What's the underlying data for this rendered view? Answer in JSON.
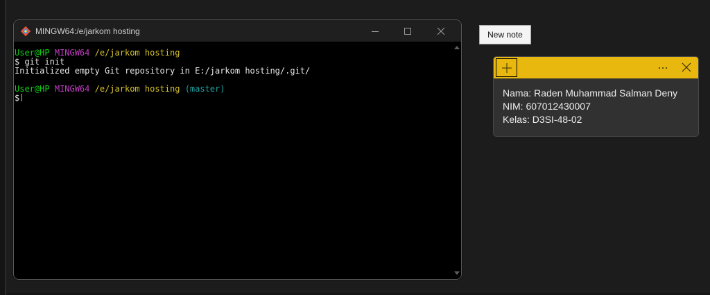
{
  "terminal": {
    "title": "MINGW64:/e/jarkom hosting",
    "lines": {
      "prompt1": {
        "user": "User@HP",
        "shell": "MINGW64",
        "path": "/e/jarkom hosting"
      },
      "cmd1": "$ git init",
      "out1": "Initialized empty Git repository in E:/jarkom hosting/.git/",
      "prompt2": {
        "user": "User@HP",
        "shell": "MINGW64",
        "path": "/e/jarkom hosting",
        "branch": "(master)"
      },
      "cmd2": "$"
    },
    "colors": {
      "user": "#11d116",
      "shell": "#c33cc3",
      "path": "#d7c42d",
      "branch": "#1da4a2"
    },
    "icons": {
      "app": "git-bash-icon",
      "minimize": "minimize-icon",
      "maximize": "maximize-icon",
      "close": "close-icon",
      "scroll_up": "scroll-up-arrow-icon",
      "scroll_down": "scroll-down-arrow-icon"
    }
  },
  "tooltip": {
    "text": "New note"
  },
  "sticky_note": {
    "accent": "#e8b80f",
    "lines": [
      "Nama: Raden Muhammad Salman Deny",
      "NIM: 607012430007",
      "Kelas: D3SI-48-02"
    ],
    "icons": {
      "add": "plus-icon",
      "more": "more-options-icon",
      "close": "close-icon"
    }
  }
}
